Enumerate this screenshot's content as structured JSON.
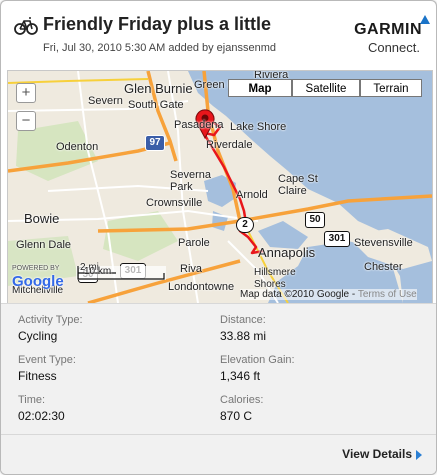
{
  "header": {
    "activity_icon": "bicycle-icon",
    "title": "Friendly Friday plus a little",
    "subtitle": "Fri, Jul 30, 2010 5:30 AM added by ejanssenmd"
  },
  "brand": {
    "name": "GARMIN",
    "tagline": "Connect."
  },
  "map": {
    "types": [
      "Map",
      "Satellite",
      "Terrain"
    ],
    "selected_type": "Map",
    "zoom_in_label": "+",
    "zoom_out_label": "−",
    "labels": {
      "glen_burnie": "Glen Burnie",
      "severn": "Severn",
      "south_gate": "South Gate",
      "odenton": "Odenton",
      "pasadena": "Pasadena",
      "lake_shore": "Lake Shore",
      "riverdale": "Riverdale",
      "severna_park": "Severna\nPark",
      "crownsville": "Crownsville",
      "arnold": "Arnold",
      "cape_st_claire": "Cape St\nClaire",
      "bowie": "Bowie",
      "glenn_dale": "Glenn Dale",
      "parole": "Parole",
      "annapolis": "Annapolis",
      "riva": "Riva",
      "stevensville": "Stevensville",
      "chester": "Chester",
      "hillsmere": "Hillsmere\nShores",
      "londontowne": "Londontowne",
      "mitchellville": "Mitchellville",
      "greenhaven": "Green Haven",
      "riviera": "Riviera",
      "powered_by": "POWERED BY",
      "google": "Google"
    },
    "shields": {
      "i97": "97",
      "us50": "50",
      "us301a": "301",
      "us301b": "301",
      "md2": "2",
      "us50b": "50"
    },
    "scale": {
      "miles": "2 mi",
      "km": "10 km"
    },
    "attribution": "Map data ©2010 Google - ",
    "terms_link": "Terms of Use"
  },
  "stats": {
    "activity_type": {
      "label": "Activity Type:",
      "value": "Cycling"
    },
    "distance": {
      "label": "Distance:",
      "value": "33.88 mi"
    },
    "event_type": {
      "label": "Event Type:",
      "value": "Fitness"
    },
    "elevation_gain": {
      "label": "Elevation Gain:",
      "value": "1,346 ft"
    },
    "time": {
      "label": "Time:",
      "value": "02:02:30"
    },
    "calories": {
      "label": "Calories:",
      "value": "870 C"
    }
  },
  "footer": {
    "view_details": "View Details"
  },
  "colors": {
    "route": "#e8161b",
    "water": "#a5bfdd",
    "highway": "#f7a23b",
    "accent": "#2a7fd4"
  }
}
